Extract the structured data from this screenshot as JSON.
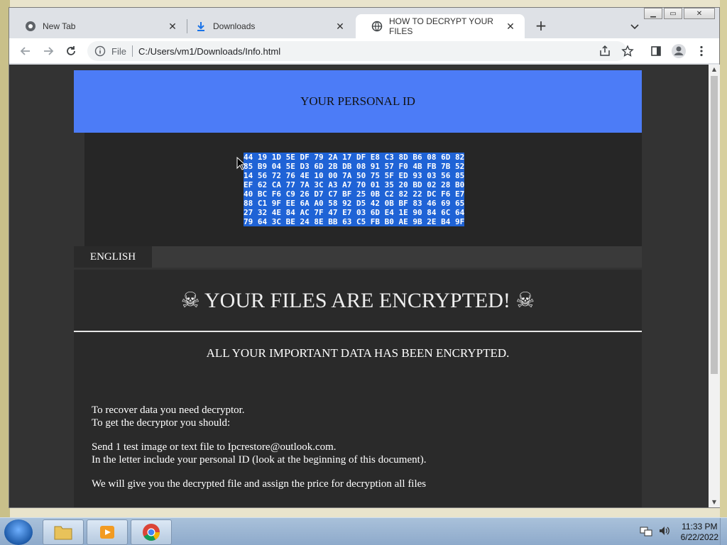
{
  "browser": {
    "tabs": [
      {
        "label": "New Tab",
        "icon": "chrome-icon"
      },
      {
        "label": "Downloads",
        "icon": "download-icon"
      },
      {
        "label": "HOW TO DECRYPT YOUR FILES",
        "icon": "globe-icon"
      }
    ],
    "address": {
      "scheme": "File",
      "url": "C:/Users/vm1/Downloads/Info.html"
    }
  },
  "page": {
    "id_header": "YOUR PERSONAL ID",
    "personal_id_lines": [
      "44 19 1D 5E DF 79 2A 17 DF E8 C3 8D B6 08 6D 82",
      "85 B9 04 5E D3 6D 2B DB 08 91 57 F0 4B FB 7B 52",
      "14 56 72 76 4E 10 00 7A 50 75 5F ED 93 03 56 85",
      "EF 62 CA 77 7A 3C A3 A7 70 01 35 20 BD 02 28 B0",
      "40 BC F6 C9 26 D7 C7 BF 25 0B C2 82 22 DC F6 E7",
      "88 C1 9F EE 6A A0 58 92 D5 42 0B BF 83 46 69 65",
      "27 32 4E 84 AC 7F 47 E7 03 6D E4 1E 90 84 6C 64",
      "79 64 3C BE 24 8E BB 63 C5 FB B0 AE 9B 2E B4 9F"
    ],
    "language_tab": "ENGLISH",
    "title": "☠ YOUR FILES ARE ENCRYPTED! ☠",
    "subtitle": "ALL YOUR IMPORTANT DATA HAS BEEN ENCRYPTED.",
    "paragraphs": [
      "To recover data you need decryptor.",
      "To get the decryptor you should:",
      "Send 1 test image or text file to Ipcrestore@outlook.com.",
      "In the letter include your personal ID (look at the beginning of this document).",
      "We will give you the decrypted file and assign the price for decryption all files"
    ]
  },
  "taskbar": {
    "time": "11:33 PM",
    "date": "6/22/2022"
  }
}
